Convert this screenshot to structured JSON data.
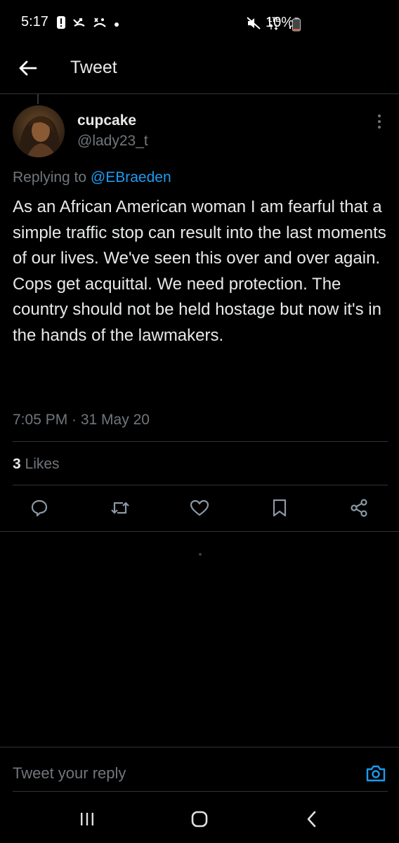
{
  "status_bar": {
    "time": "5:17",
    "network": "LTE",
    "battery_percent": "10%",
    "battery_level": 0.1,
    "icons_left": [
      "alert-icon",
      "missed-call-icon",
      "voicemail-icon",
      "dot-icon"
    ],
    "icons_right": [
      "mute-icon",
      "lte-icon",
      "signal-icon",
      "battery-icon"
    ]
  },
  "header": {
    "title": "Tweet",
    "back_icon": "arrow-left-icon"
  },
  "tweet": {
    "display_name": "cupcake",
    "handle": "@lady23_t",
    "replying_to_label": "Replying to",
    "replying_to_handle": "@EBraeden",
    "text": "As an African American woman I am fearful that a simple traffic stop can result into the last moments of our lives. We've seen this over and over again. Cops get acquittal. We need protection. The country should not be held hostage but now it's in the hands of the lawmakers.",
    "timestamp": "7:05 PM · 31 May 20",
    "likes_count": "3",
    "likes_label": "Likes"
  },
  "actions": [
    "reply-icon",
    "retweet-icon",
    "like-icon",
    "bookmark-icon",
    "share-icon"
  ],
  "reply_bar": {
    "placeholder": "Tweet your reply",
    "camera_icon": "camera-icon"
  },
  "nav_bar": [
    "recents-icon",
    "home-icon",
    "back-icon"
  ],
  "colors": {
    "background": "#000000",
    "text_primary": "#e7e9ea",
    "text_secondary": "#71767b",
    "accent": "#1d9bf0",
    "divider": "#2f3336"
  }
}
